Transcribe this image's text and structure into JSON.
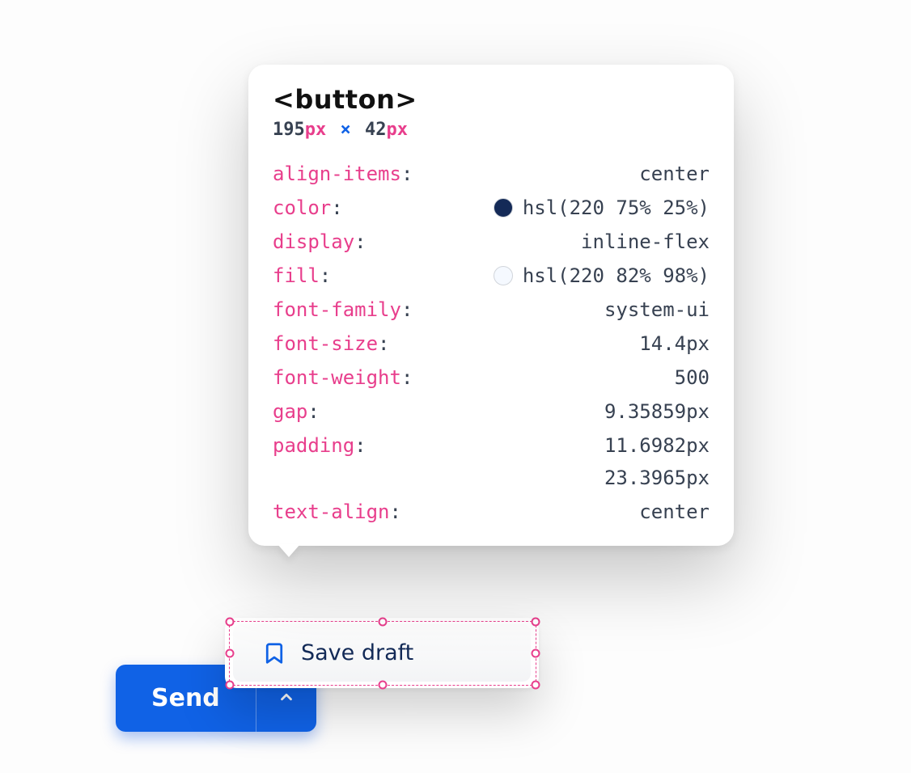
{
  "inspector": {
    "tag": "<button>",
    "dims": {
      "w": "195",
      "h": "42",
      "unit": "px"
    },
    "properties": [
      {
        "key": "align-items",
        "value": "center"
      },
      {
        "key": "color",
        "value": "hsl(220 75% 25%)",
        "swatch": "#142a57"
      },
      {
        "key": "display",
        "value": "inline-flex"
      },
      {
        "key": "fill",
        "value": "hsl(220 82% 98%)",
        "swatch": "#f5f9ff"
      },
      {
        "key": "font-family",
        "value": "system-ui"
      },
      {
        "key": "font-size",
        "value": "14.4px"
      },
      {
        "key": "font-weight",
        "value": "500"
      },
      {
        "key": "gap",
        "value": "9.35859px"
      },
      {
        "key": "padding",
        "value": "11.6982px",
        "value2": "23.3965px"
      },
      {
        "key": "text-align",
        "value": "center"
      }
    ]
  },
  "menu": {
    "save_draft_label": "Save draft"
  },
  "send": {
    "label": "Send"
  }
}
